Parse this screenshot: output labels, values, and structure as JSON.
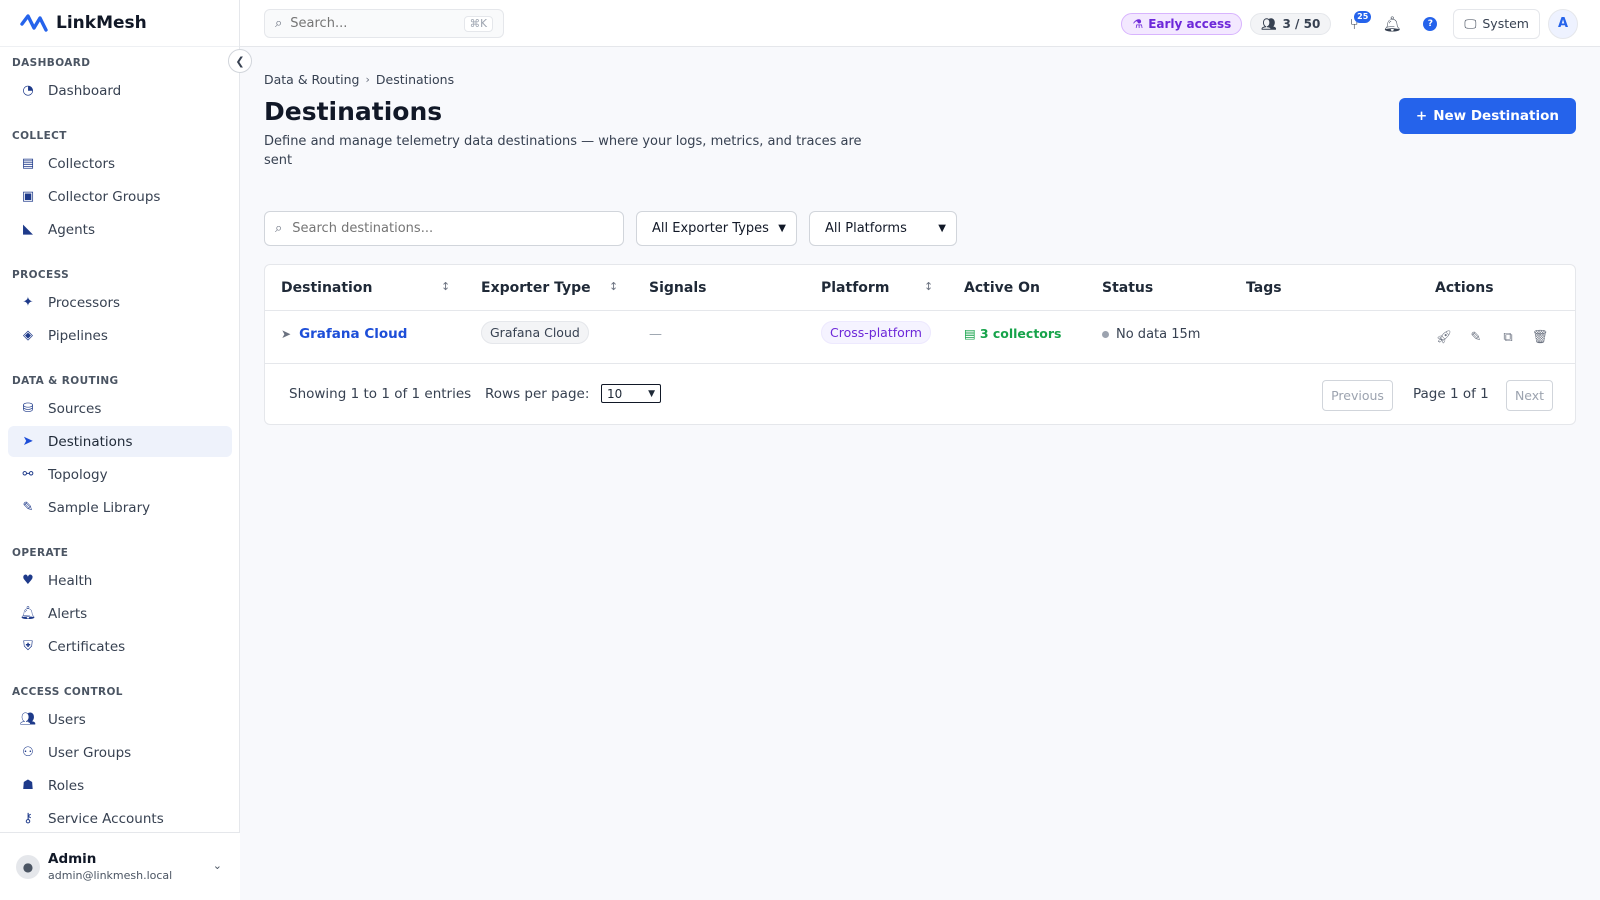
{
  "app": {
    "name": "LinkMesh"
  },
  "topbar": {
    "search_placeholder": "Search...",
    "search_shortcut": "⌘K",
    "early_access_label": "Early access",
    "seats_label": "3 / 50",
    "pr_count": "25",
    "system_label": "System",
    "avatar_initial": "A"
  },
  "sidebar": {
    "sections": [
      {
        "title": "Dashboard",
        "items": [
          {
            "label": "Dashboard",
            "icon": "gauge-icon"
          }
        ]
      },
      {
        "title": "Collect",
        "items": [
          {
            "label": "Collectors",
            "icon": "server-icon"
          },
          {
            "label": "Collector Groups",
            "icon": "object-group-icon"
          },
          {
            "label": "Agents",
            "icon": "satellite-dish-icon"
          }
        ]
      },
      {
        "title": "Process",
        "items": [
          {
            "label": "Processors",
            "icon": "magic-wand-icon"
          },
          {
            "label": "Pipelines",
            "icon": "layers-icon"
          }
        ]
      },
      {
        "title": "Data & Routing",
        "items": [
          {
            "label": "Sources",
            "icon": "database-icon"
          },
          {
            "label": "Destinations",
            "icon": "paper-plane-icon",
            "active": true
          },
          {
            "label": "Topology",
            "icon": "sitemap-icon"
          },
          {
            "label": "Sample Library",
            "icon": "pen-icon"
          }
        ]
      },
      {
        "title": "Operate",
        "items": [
          {
            "label": "Health",
            "icon": "heart-pulse-icon"
          },
          {
            "label": "Alerts",
            "icon": "bell-icon"
          },
          {
            "label": "Certificates",
            "icon": "shield-icon"
          }
        ]
      },
      {
        "title": "Access Control",
        "items": [
          {
            "label": "Users",
            "icon": "users-icon"
          },
          {
            "label": "User Groups",
            "icon": "people-group-icon"
          },
          {
            "label": "Roles",
            "icon": "user-tag-icon"
          },
          {
            "label": "Service Accounts",
            "icon": "key-icon"
          }
        ]
      }
    ],
    "user": {
      "name": "Admin",
      "email": "admin@linkmesh.local"
    }
  },
  "main": {
    "breadcrumb": [
      "Data & Routing",
      "Destinations"
    ],
    "title": "Destinations",
    "description": "Define and manage telemetry data destinations — where your logs, metrics, and traces are sent",
    "new_button_label": "New Destination",
    "filters": {
      "search_placeholder": "Search destinations...",
      "exporter_type_selected": "All Exporter Types",
      "platform_selected": "All Platforms"
    },
    "table": {
      "columns": [
        "Destination",
        "Exporter Type",
        "Signals",
        "Platform",
        "Active On",
        "Status",
        "Tags",
        "Actions"
      ],
      "rows": [
        {
          "destination": "Grafana Cloud",
          "exporter_type": "Grafana Cloud",
          "signals": "—",
          "platform": "Cross-platform",
          "active_on": "3 collectors",
          "status": "No data 15m",
          "tags": ""
        }
      ]
    },
    "pagination": {
      "showing": "Showing 1 to 1 of 1 entries",
      "rows_per_page_label": "Rows per page:",
      "rows_per_page_value": "10",
      "previous_label": "Previous",
      "page_label": "Page 1 of 1",
      "next_label": "Next"
    }
  },
  "colors": {
    "accent": "#2563eb",
    "success": "#16a34a",
    "early_access": "#6d28d9"
  }
}
